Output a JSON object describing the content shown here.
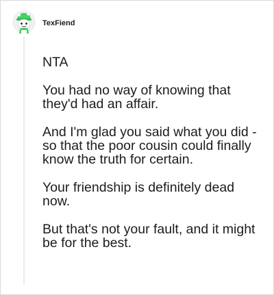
{
  "comment": {
    "author": "TexFiend",
    "avatar_icon": "snoo-avatar-icon",
    "paragraphs": [
      "NTA",
      "You had no way of knowing that they'd had an affair.",
      "And I'm glad you said what you did - so that the poor cousin could finally know the truth for certain.",
      "Your friendship is definitely dead now.",
      "But that's not your fault, and it might be for the best."
    ]
  },
  "colors": {
    "border": "#d9d9d9",
    "text": "#1c1c1c",
    "thread_line": "#ebebeb",
    "avatar_green": "#46d160"
  }
}
